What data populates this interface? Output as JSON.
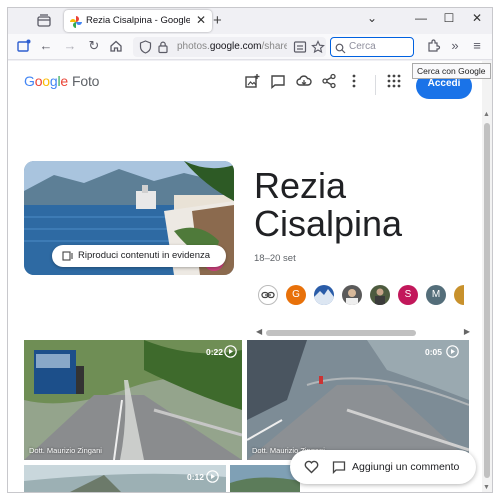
{
  "browser": {
    "tab_title": "Rezia Cisalpina - Google Foto",
    "url_host_prefix": "photos.",
    "url_host": "google.com",
    "url_path": "/share/AF",
    "search_placeholder": "Cerca",
    "tooltip": "Cerca con Google",
    "new_tab_glyph": "+",
    "close_glyph": "✕",
    "minimize_glyph": "—",
    "maximize_glyph": "☐",
    "chevron_glyph": "⌄"
  },
  "header": {
    "logo_letters": [
      "G",
      "o",
      "o",
      "g",
      "l",
      "e"
    ],
    "logo_product": "Foto",
    "signin_label": "Accedi",
    "brand_blue": "#1a73e8"
  },
  "album": {
    "title": "Rezia Cisalpina",
    "dates": "18–20 set",
    "highlight_button": "Riproduci contenuti in evidenza",
    "contributors": [
      {
        "initial": "",
        "color": "#ffffff",
        "kind": "link-icon"
      },
      {
        "initial": "G",
        "color": "#e8710a",
        "kind": "letter"
      },
      {
        "initial": "",
        "color": "#2a5ca8",
        "kind": "photo"
      },
      {
        "initial": "",
        "color": "#5a5a5a",
        "kind": "photo"
      },
      {
        "initial": "",
        "color": "#4d5b3f",
        "kind": "photo"
      },
      {
        "initial": "S",
        "color": "#c2185b",
        "kind": "letter"
      },
      {
        "initial": "M",
        "color": "#546e7a",
        "kind": "letter"
      },
      {
        "initial": "",
        "color": "#c8912c",
        "kind": "photo"
      }
    ]
  },
  "photos": [
    {
      "duration": "0:22",
      "owner": "Dott. Maurizio Zingani"
    },
    {
      "duration": "0:05",
      "owner": "Dott. Maurizio Zingani"
    },
    {
      "duration": "0:12",
      "owner": ""
    },
    {
      "duration": "",
      "owner": ""
    }
  ],
  "comment": {
    "label": "Aggiungi un commento"
  }
}
